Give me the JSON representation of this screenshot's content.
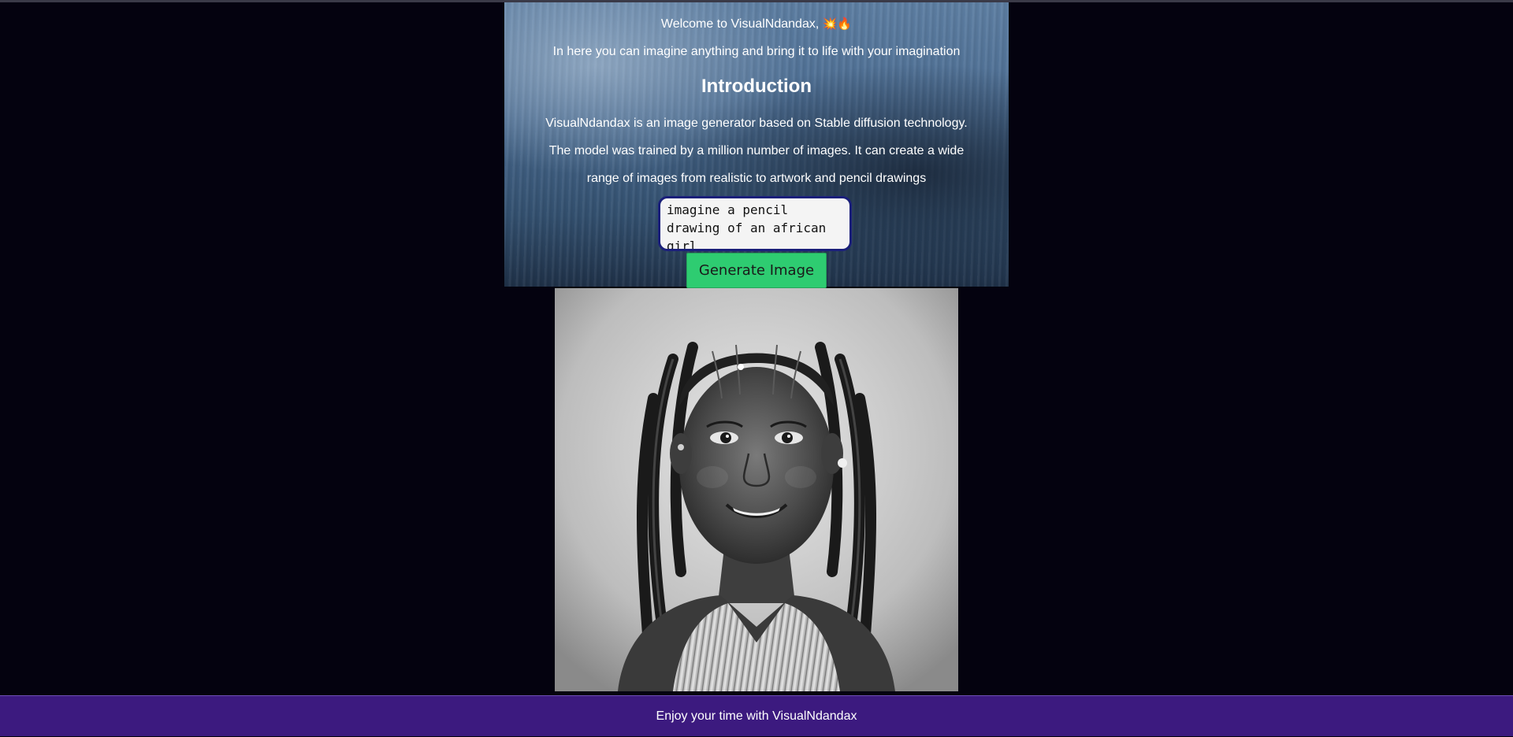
{
  "hero": {
    "welcome": "Welcome to VisualNdandax,",
    "welcome_emojis": "💥🔥",
    "tagline": "In here you can imagine anything and bring it to life with your imagination",
    "heading": "Introduction",
    "paragraph": "VisualNdandax is an image generator based on Stable diffusion technology. The model was trained by a million number of images. It can create a wide range of images from realistic to artwork and pencil drawings"
  },
  "prompt": {
    "value": "imagine a pencil drawing of an african girl "
  },
  "generate_button": {
    "label": "Generate Image"
  },
  "result_image": {
    "description_icon": "generated-portrait-image"
  },
  "footer": {
    "text": "Enjoy your time with VisualNdandax"
  },
  "colors": {
    "background": "#04020f",
    "footer": "#3c1a7f",
    "button": "#2ecc71",
    "input_border": "#1a1f7a"
  }
}
